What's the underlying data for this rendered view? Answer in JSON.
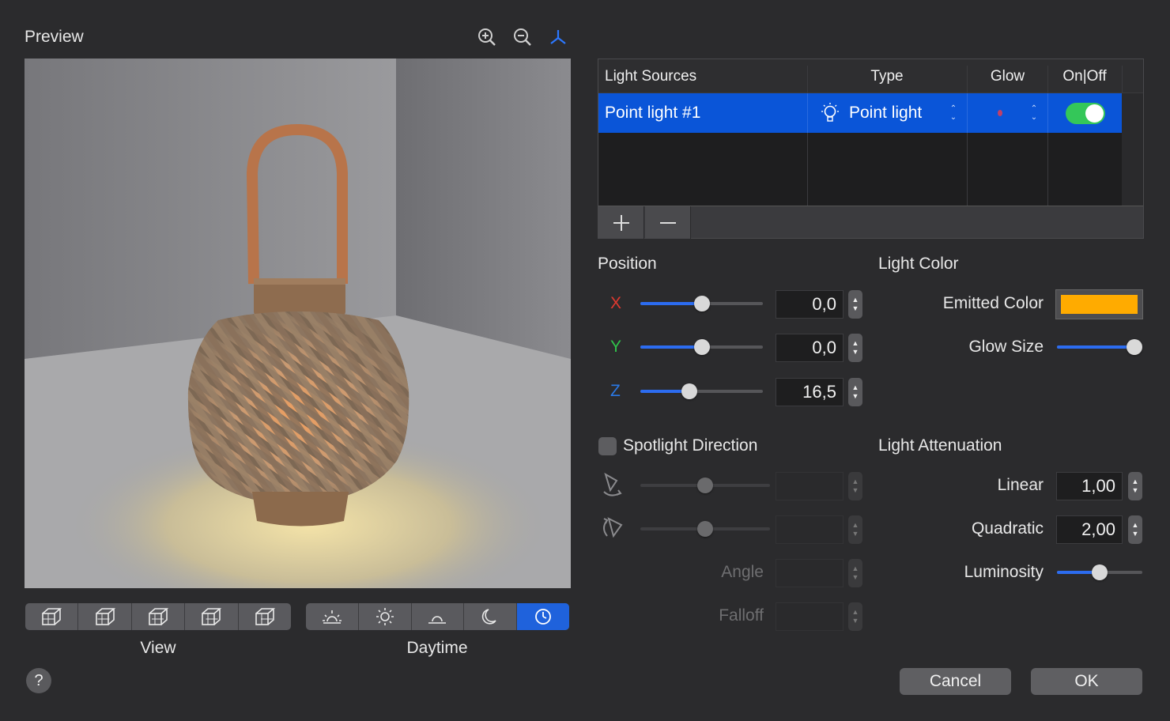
{
  "preview": {
    "title": "Preview",
    "toolbar": {
      "zoom_in_icon": "zoom-in-icon",
      "zoom_out_icon": "zoom-out-icon",
      "axes_icon": "axes-icon"
    },
    "view_label": "View",
    "daytime_label": "Daytime",
    "view_buttons": [
      "cube-view-1-icon",
      "cube-view-2-icon",
      "cube-view-3-icon",
      "cube-view-4-icon",
      "cube-view-5-icon"
    ],
    "daytime_buttons": [
      "sunrise-icon",
      "sun-icon",
      "sunset-icon",
      "moon-icon",
      "clock-icon"
    ],
    "daytime_selected": "clock-icon"
  },
  "light_sources": {
    "headers": {
      "name": "Light Sources",
      "type": "Type",
      "glow": "Glow",
      "onoff": "On|Off"
    },
    "rows": [
      {
        "name": "Point light #1",
        "type": "Point light",
        "on": true
      }
    ],
    "add_icon": "plus-icon",
    "remove_icon": "minus-icon"
  },
  "position": {
    "title": "Position",
    "x": {
      "label": "X",
      "value": "0,0",
      "slider": 0.5
    },
    "y": {
      "label": "Y",
      "value": "0,0",
      "slider": 0.5
    },
    "z": {
      "label": "Z",
      "value": "16,5",
      "slider": 0.4
    }
  },
  "spotlight": {
    "title": "Spotlight Direction",
    "checked": false,
    "angle_label": "Angle",
    "falloff_label": "Falloff"
  },
  "light_color": {
    "title": "Light Color",
    "emitted_label": "Emitted Color",
    "emitted_color": "#ffab00",
    "glow_size_label": "Glow Size",
    "glow_size": 1.0
  },
  "attenuation": {
    "title": "Light Attenuation",
    "linear_label": "Linear",
    "linear_value": "1,00",
    "quadratic_label": "Quadratic",
    "quadratic_value": "2,00",
    "luminosity_label": "Luminosity",
    "luminosity": 0.5
  },
  "buttons": {
    "help": "?",
    "cancel": "Cancel",
    "ok": "OK"
  },
  "colors": {
    "accent": "#1f62dc",
    "toggle_on": "#34c759",
    "x_axis": "#e0392f",
    "y_axis": "#30c24a",
    "z_axis": "#2a78e4"
  }
}
